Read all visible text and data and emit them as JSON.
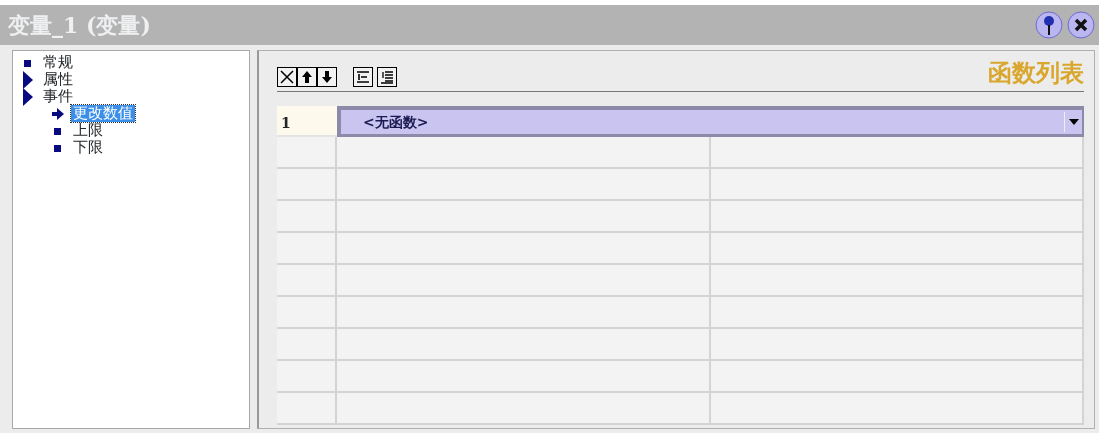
{
  "window": {
    "title": "变量_1 (变量)"
  },
  "tree": [
    {
      "label": "常规",
      "kind": "leaf",
      "selected": false
    },
    {
      "label": "属性",
      "kind": "branch",
      "selected": false
    },
    {
      "label": "事件",
      "kind": "branch",
      "selected": false,
      "children": [
        {
          "label": "更改数值",
          "kind": "leaf",
          "selected": true
        },
        {
          "label": "上限",
          "kind": "leaf",
          "selected": false
        },
        {
          "label": "下限",
          "kind": "leaf",
          "selected": false
        }
      ]
    }
  ],
  "panel": {
    "heading": "函数列表"
  },
  "table": {
    "rows": [
      {
        "number": "1",
        "function": "<无函数>",
        "selected": true
      }
    ]
  }
}
